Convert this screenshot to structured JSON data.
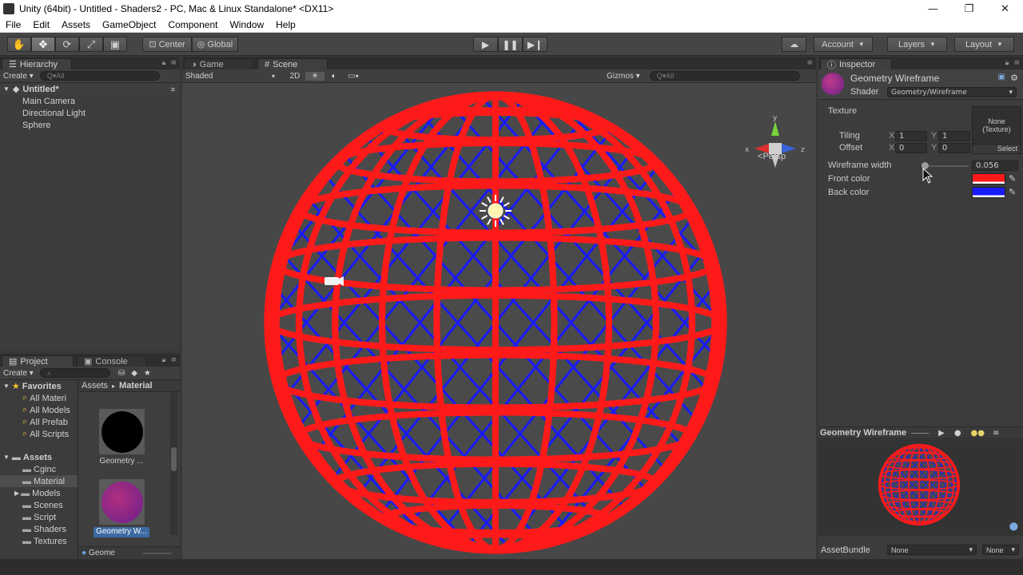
{
  "window": {
    "title": "Unity (64bit) - Untitled - Shaders2 - PC, Mac & Linux Standalone* <DX11>",
    "controls": [
      "—",
      "❐",
      "✕"
    ]
  },
  "menu": [
    "File",
    "Edit",
    "Assets",
    "GameObject",
    "Component",
    "Window",
    "Help"
  ],
  "toolbar": {
    "tools": [
      "hand-tool",
      "move-tool",
      "rotate-tool",
      "scale-tool",
      "rect-tool"
    ],
    "pivot": "Center",
    "space": "Global",
    "account": "Account",
    "layers": "Layers",
    "layout": "Layout"
  },
  "hierarchy": {
    "tab": "Hierarchy",
    "create": "Create",
    "search_placeholder": "Q▾All",
    "scene": "Untitled*",
    "items": [
      "Main Camera",
      "Directional Light",
      "Sphere"
    ]
  },
  "scene": {
    "tabs": [
      "Game",
      "Scene"
    ],
    "shading": "Shaded",
    "mode_2d": "2D",
    "gizmos": "Gizmos",
    "search_placeholder": "Q▾All",
    "projection": "Persp",
    "axes": [
      "y",
      "x",
      "z"
    ],
    "colors": {
      "wire_front": "#ff1a1a",
      "wire_back": "#1a1aff",
      "background": "#474747"
    }
  },
  "project": {
    "tabs": [
      "Project",
      "Console"
    ],
    "create": "Create",
    "favorites_label": "Favorites",
    "favorites": [
      "All Materi",
      "All Models",
      "All Prefab",
      "All Scripts"
    ],
    "assets_label": "Assets",
    "folders": [
      "Cginc",
      "Material",
      "Models",
      "Scenes",
      "Script",
      "Shaders",
      "Textures"
    ],
    "breadcrumb": [
      "Assets",
      "Material"
    ],
    "thumbs": [
      "Geometry ...",
      "Geometry W..."
    ],
    "bottom_item": "Geome"
  },
  "inspector": {
    "tab": "Inspector",
    "material_name": "Geometry Wireframe",
    "shader_label": "Shader",
    "shader_value": "Geometry/Wireframe",
    "texture_label": "Texture",
    "texture_value": "None\n(Texture)",
    "tiling_label": "Tiling",
    "offset_label": "Offset",
    "tiling": {
      "x": "1",
      "y": "1"
    },
    "offset": {
      "x": "0",
      "y": "0"
    },
    "x_label": "X",
    "y_label": "Y",
    "select": "Select",
    "wire_width_label": "Wireframe width",
    "wire_width_value": "0.056",
    "wire_width_fraction": 0.056,
    "front_color_label": "Front color",
    "back_color_label": "Back color",
    "front_color": "#ff1a1a",
    "back_color": "#1a1aff",
    "preview_title": "Geometry Wireframe",
    "assetbundle_label": "AssetBundle",
    "assetbundle_value": "None",
    "assetbundle_variant": "None"
  }
}
